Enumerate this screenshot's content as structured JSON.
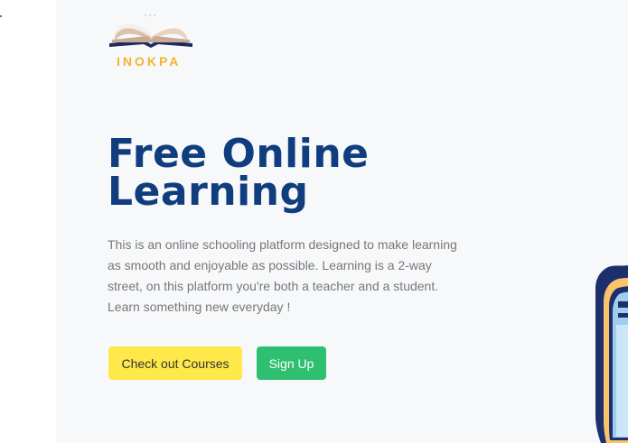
{
  "brand": {
    "name": "INOKPA",
    "logo_icon": "open-book-icon",
    "logo_color": "#f2b530"
  },
  "hero": {
    "title_line1": "Free Online",
    "title_line2": "Learning",
    "description": "This is an online schooling platform designed to make learning as smooth and enjoyable as possible. Learning is a 2-way street, on this platform you're both a teacher and a student. Learn something new everyday !"
  },
  "actions": {
    "courses_label": "Check out Courses",
    "signup_label": "Sign Up"
  },
  "illustration": {
    "icon": "book-illustration-icon"
  },
  "colors": {
    "heading": "#0f3d7d",
    "courses_button": "#ffe84a",
    "signup_button": "#2fbf71",
    "page_background": "#f7f8fa"
  }
}
